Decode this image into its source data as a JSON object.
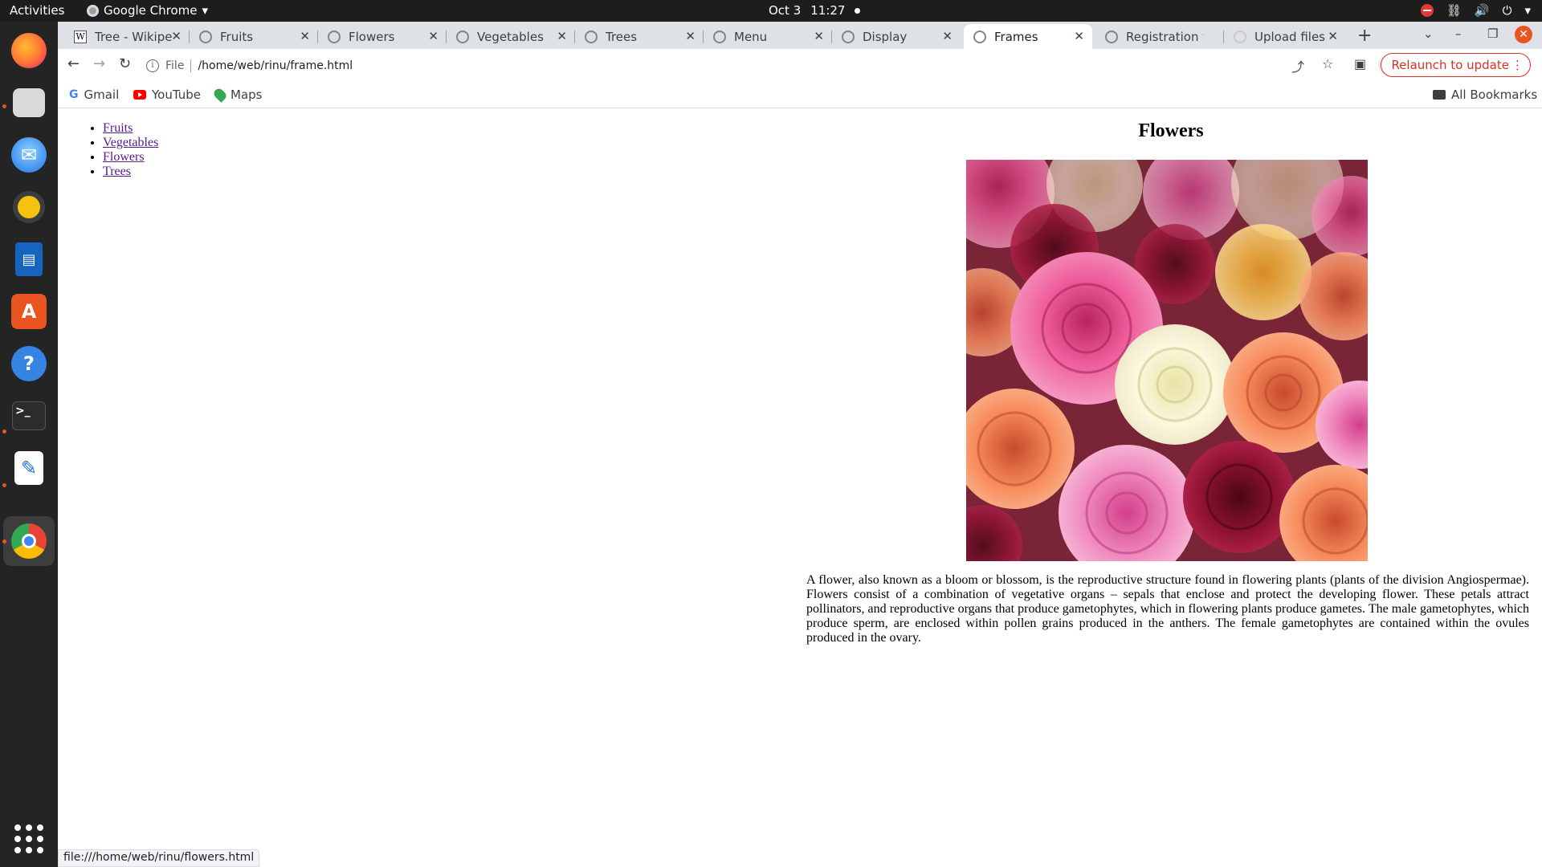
{
  "topbar": {
    "activities": "Activities",
    "app_name": "Google Chrome",
    "date": "Oct 3",
    "time": "11:27"
  },
  "dock": {
    "items": [
      "firefox-icon",
      "files-icon",
      "thunderbird-icon",
      "rhythmbox-icon",
      "libreoffice-writer-icon",
      "app-center-icon",
      "help-icon",
      "terminal-icon",
      "text-editor-icon",
      "chrome-icon"
    ]
  },
  "tabs": [
    {
      "label": "Tree - Wikipe"
    },
    {
      "label": "Fruits"
    },
    {
      "label": "Flowers"
    },
    {
      "label": "Vegetables"
    },
    {
      "label": "Trees"
    },
    {
      "label": "Menu"
    },
    {
      "label": "Display"
    },
    {
      "label": "Frames",
      "active": true
    },
    {
      "label": "Registration f"
    },
    {
      "label": "Upload files"
    }
  ],
  "toolbar": {
    "scheme": "File",
    "url": "/home/web/rinu/frame.html",
    "relaunch": "Relaunch to update"
  },
  "bookmarks": {
    "items": [
      "Gmail",
      "YouTube",
      "Maps"
    ],
    "all": "All Bookmarks"
  },
  "nav_frame": {
    "links": [
      "Fruits",
      "Vegetables",
      "Flowers",
      "Trees"
    ]
  },
  "content_frame": {
    "heading": "Flowers",
    "paragraph": "A flower, also known as a bloom or blossom, is the reproductive structure found in flowering plants (plants of the division Angiospermae). Flowers consist of a combination of vegetative organs – sepals that enclose and protect the developing flower. These petals attract pollinators, and reproductive organs that produce gametophytes, which in flowering plants produce gametes. The male gametophytes, which produce sperm, are enclosed within pollen grains produced in the anthers. The female gametophytes are contained within the ovules produced in the ovary."
  },
  "status_url": "file:///home/web/rinu/flowers.html",
  "colors": {
    "accent": "#e95420",
    "tabstrip": "#dee1e6",
    "link_visited": "#551a8b",
    "relaunch": "#d93025"
  }
}
